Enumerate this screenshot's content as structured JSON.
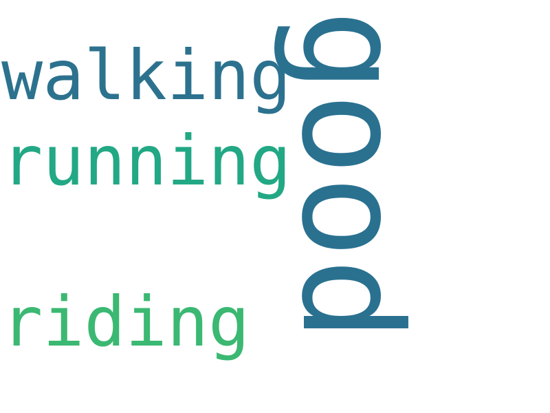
{
  "words": {
    "good": "good",
    "walking": "walking",
    "running": "running",
    "riding": "riding"
  },
  "colors": {
    "good": "#2a7190",
    "walking": "#2c728e",
    "running": "#22a884",
    "riding": "#3bb872"
  }
}
